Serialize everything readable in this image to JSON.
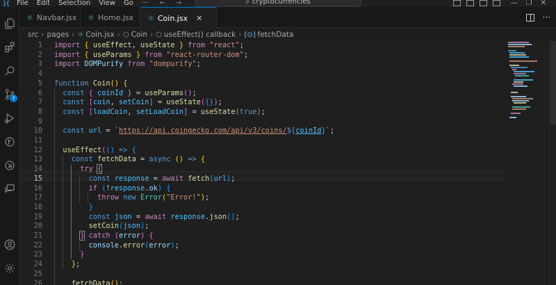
{
  "titlebar": {
    "menu": [
      "File",
      "Edit",
      "Selection",
      "View",
      "Go",
      "···"
    ],
    "search": "cryptocurrencies",
    "back_icon": "arrow-left-icon",
    "forward_icon": "arrow-right-icon"
  },
  "activity": [
    {
      "name": "explorer-icon"
    },
    {
      "name": "extensions-icon"
    },
    {
      "name": "search-icon"
    },
    {
      "name": "source-control-icon",
      "badge": "7"
    },
    {
      "name": "run-debug-icon"
    },
    {
      "name": "git-graph-icon"
    },
    {
      "name": "remote-explorer-icon"
    },
    {
      "name": "chat-icon"
    },
    {
      "name": "account-icon"
    },
    {
      "name": "settings-gear-icon"
    }
  ],
  "tabs": [
    {
      "label": "Navbar.jsx",
      "active": false
    },
    {
      "label": "Home.jsx",
      "active": false
    },
    {
      "label": "Coin.jsx",
      "active": true
    }
  ],
  "breadcrumb": [
    "src",
    "pages",
    "Coin.jsx",
    "Coin",
    "useEffect() callback",
    "fetchData"
  ],
  "editor": {
    "current_line": 15,
    "line_numbers": [
      "1",
      "2",
      "3",
      "4",
      "5",
      "6",
      "7",
      "8",
      "9",
      "10",
      "11",
      "12",
      "13",
      "14",
      "15",
      "16",
      "17",
      "18",
      "19",
      "20",
      "21",
      "22",
      "23",
      "24",
      "25",
      "26"
    ]
  },
  "colors": {
    "accent": "#0078d4",
    "keyword": "#569cd6",
    "control": "#c586c0",
    "function": "#dcdcaa",
    "variable": "#9cdcfe",
    "string": "#ce9178",
    "class": "#4ec9b0"
  }
}
